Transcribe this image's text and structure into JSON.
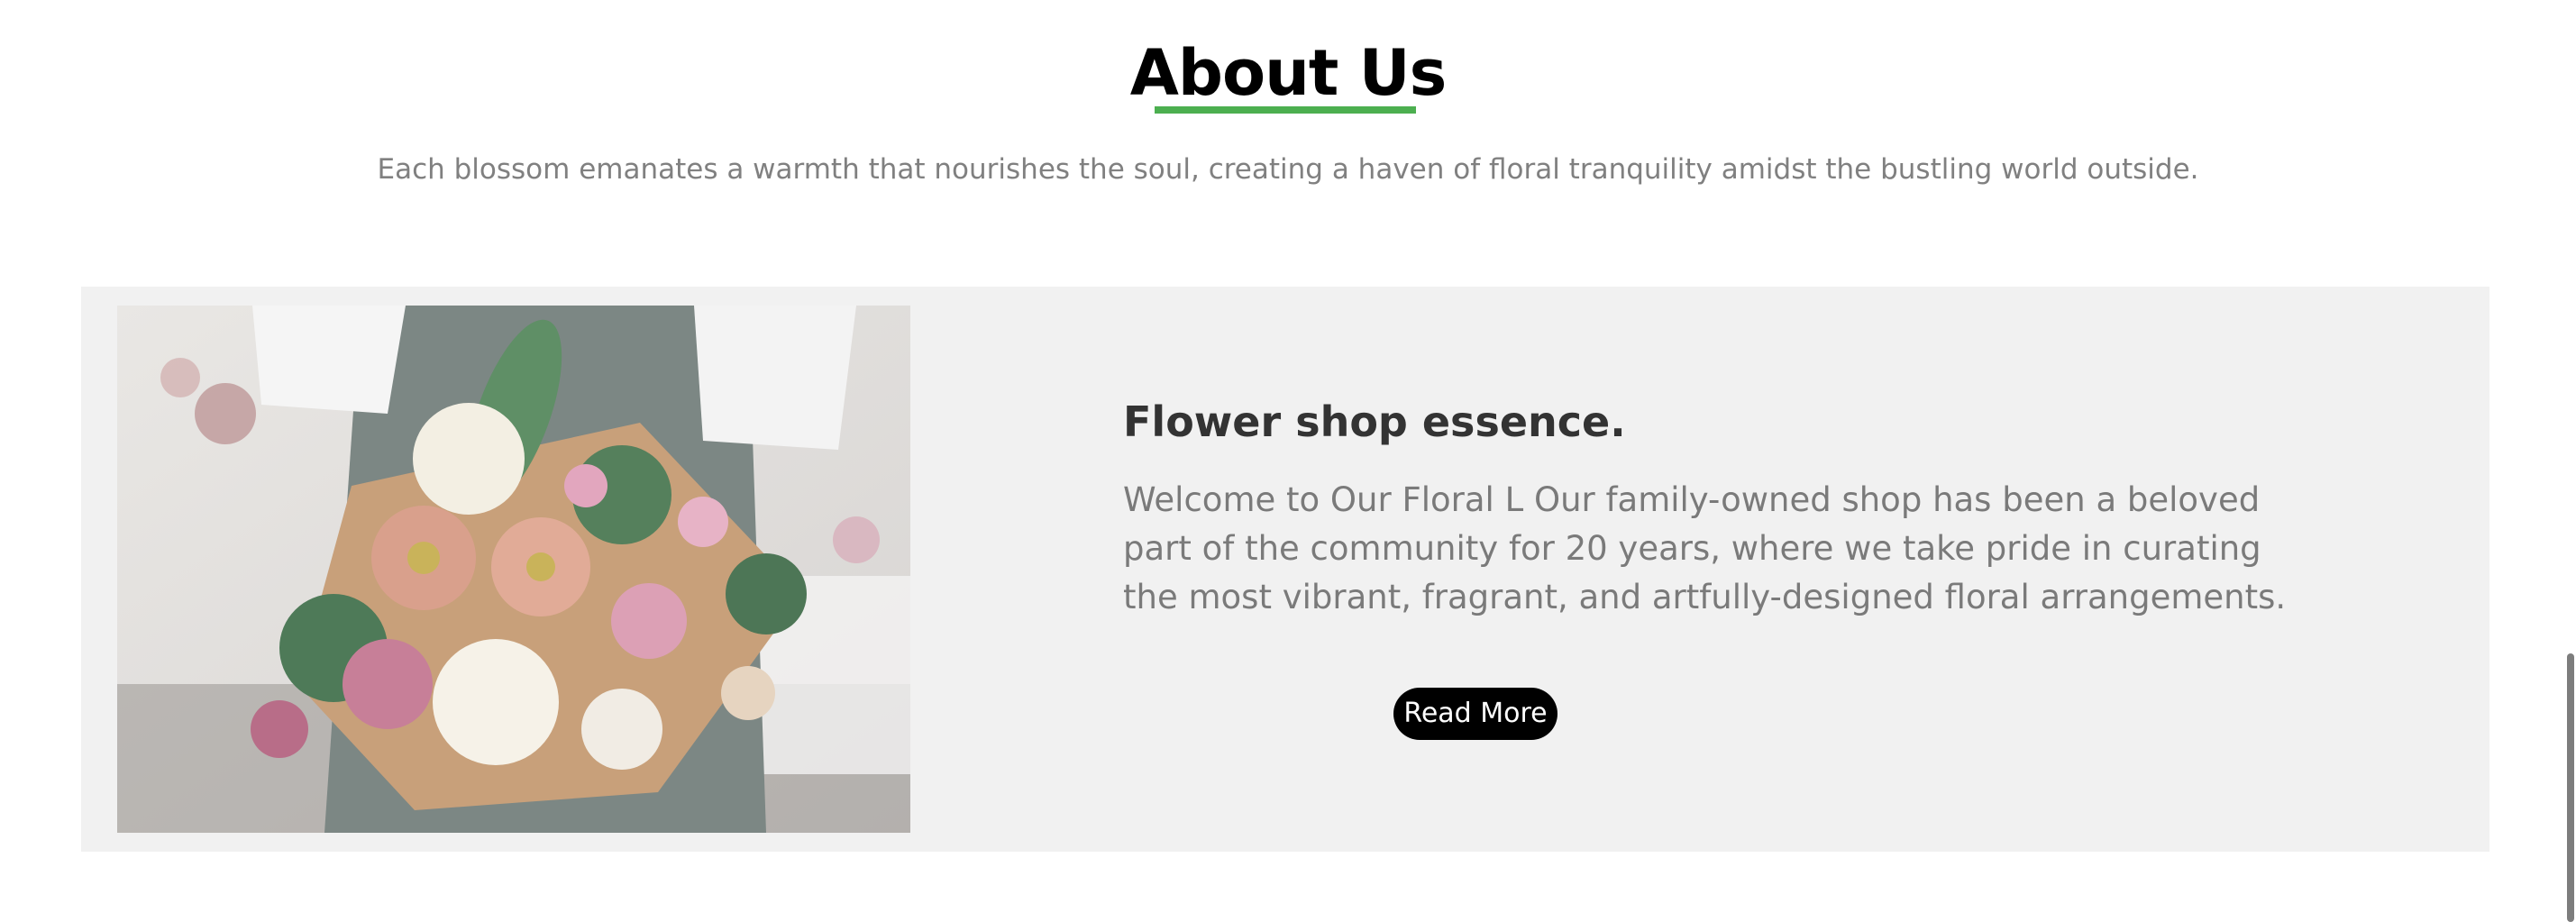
{
  "about": {
    "title": "About Us",
    "subtitle": "Each blossom emanates a warmth that nourishes the soul, creating a haven of floral tranquility amidst the bustling world outside.",
    "accent_color": "#4caf50"
  },
  "feature": {
    "image_icon": "flower-bouquet-image",
    "heading": "Flower shop essence.",
    "body": "Welcome to Our Floral L Our family-owned shop has been a beloved part of the community for 20 years, where we take pride in curating the most vibrant, fragrant, and artfully-designed floral arrangements.",
    "button_label": "Read More",
    "panel_color": "#f1f1f1",
    "button_color": "#000000"
  }
}
